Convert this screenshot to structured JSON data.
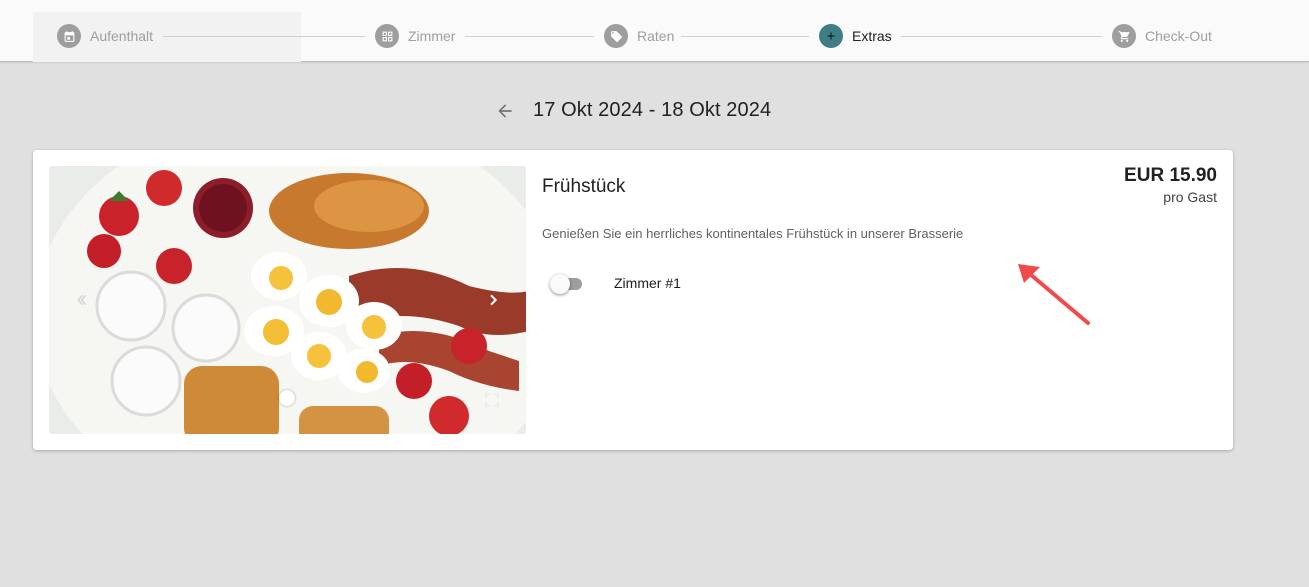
{
  "stepper": {
    "steps": [
      {
        "label": "Aufenthalt",
        "icon": "calendar-icon",
        "state": "done"
      },
      {
        "label": "Zimmer",
        "icon": "grid-icon",
        "state": "done"
      },
      {
        "label": "Raten",
        "icon": "tag-icon",
        "state": "done"
      },
      {
        "label": "Extras",
        "icon": "plus-icon",
        "state": "active"
      },
      {
        "label": "Check-Out",
        "icon": "cart-icon",
        "state": "pending"
      }
    ],
    "colors": {
      "inactive": "#9e9e9e",
      "active": "#3f7f83"
    }
  },
  "date_header": {
    "range": "17 Okt 2024 - 18 Okt 2024",
    "back_icon": "arrow-left-icon"
  },
  "extra": {
    "title": "Frühstück",
    "price": "EUR 15.90",
    "price_unit": "pro Gast",
    "description": "Genießen Sie ein herrliches kontinentales Frühstück in unserer Brasserie",
    "rooms": [
      {
        "label": "Zimmer #1",
        "selected": false
      }
    ],
    "image": {
      "subject": "breakfast-platter",
      "prev_icon": "chevron-left-icon",
      "next_icon": "chevron-right-icon",
      "fullscreen_icon": "fullscreen-icon",
      "slide_count": 1,
      "active_slide": 1
    }
  },
  "annotation": {
    "type": "red-arrow",
    "color": "#f04b4b"
  }
}
